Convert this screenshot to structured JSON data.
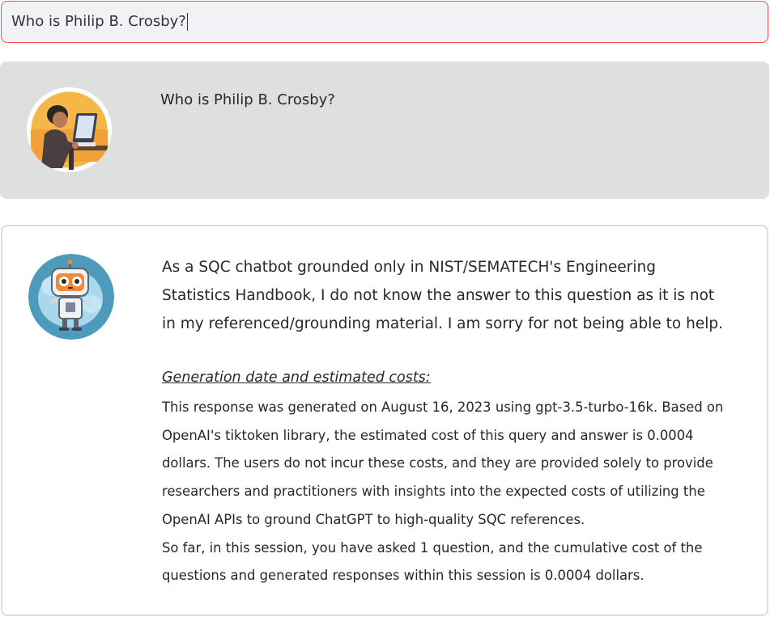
{
  "chat_input": {
    "value": "Who is Philip B. Crosby?"
  },
  "user_message": {
    "avatar": "user-at-computer-avatar",
    "text": "Who is Philip B. Crosby?"
  },
  "assistant_message": {
    "avatar": "robot-avatar",
    "answer": "As a SQC chatbot grounded only in NIST/SEMATECH's Engineering Statistics Handbook, I do not know the answer to this question as it is not in my referenced/grounding material. I am sorry for not being able to help.",
    "costs_heading": "Generation date and estimated costs:",
    "costs_paragraph": "This response was generated on August 16, 2023 using gpt-3.5-turbo-16k. Based on OpenAI's tiktoken library, the estimated cost of this query and answer is 0.0004 dollars. The users do not incur these costs, and they are provided solely to provide researchers and practitioners with insights into the expected costs of utilizing the OpenAI APIs to ground ChatGPT to high-quality SQC references.",
    "session_paragraph": "So far, in this session, you have asked 1 question, and the cumulative cost of the questions and generated responses within this session is 0.0004 dollars."
  },
  "colors": {
    "input_border": "#ff4b4b",
    "input_bg": "#f0f2f6",
    "user_bubble_bg": "#e0dfe0",
    "assistant_border": "#dcdcdc"
  }
}
